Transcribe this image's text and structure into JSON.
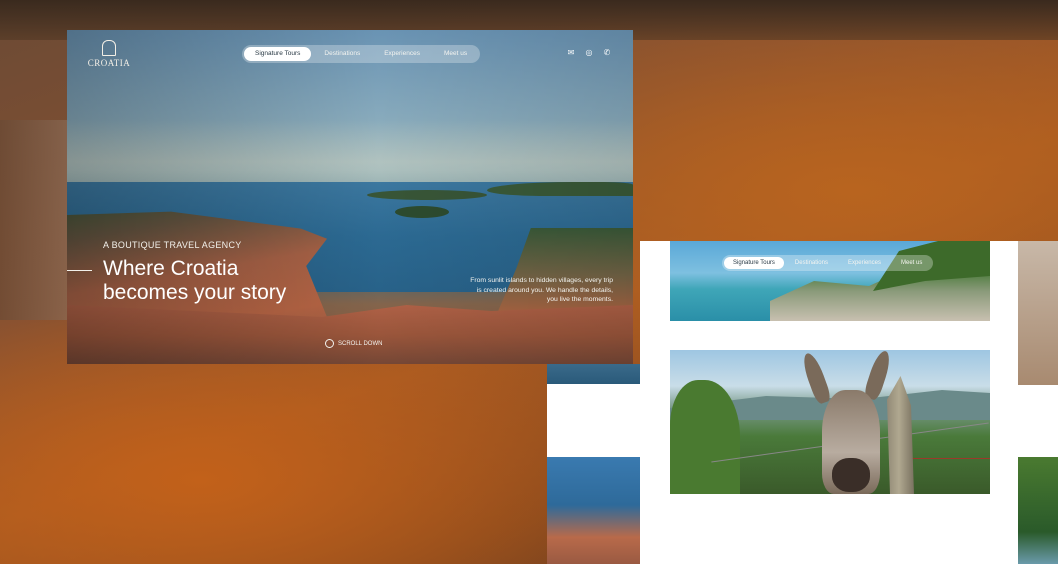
{
  "brand": {
    "name": "CROATIA",
    "logo_icon": "building-crest-icon"
  },
  "nav": {
    "items": [
      {
        "label": "Signature Tours",
        "active": true
      },
      {
        "label": "Destinations",
        "active": false
      },
      {
        "label": "Experiences",
        "active": false
      },
      {
        "label": "Meet us",
        "active": false
      }
    ]
  },
  "contact_icons": [
    "mail-icon",
    "whatsapp-icon",
    "phone-icon"
  ],
  "hero": {
    "kicker": "A BOUTIQUE TRAVEL AGENCY",
    "headline_line1": "Where Croatia",
    "headline_line2": "becomes your story",
    "description": "From sunlit islands to hidden villages, every trip is created around you. We handle the details, you live the moments.",
    "scroll_label": "SCROLL DOWN"
  },
  "second_page": {
    "nav": {
      "items": [
        {
          "label": "Signature Tours",
          "active": true
        },
        {
          "label": "Destinations",
          "active": false
        },
        {
          "label": "Experiences",
          "active": false
        },
        {
          "label": "Meet us",
          "active": false
        }
      ]
    }
  },
  "colors": {
    "background": "#8a5230",
    "nav_active_bg": "#ffffff",
    "text_light": "#ffffff",
    "page_bg": "#ffffff"
  }
}
